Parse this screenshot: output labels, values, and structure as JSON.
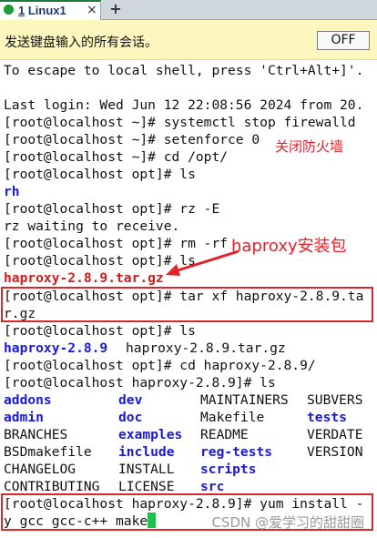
{
  "tab": {
    "number": "1",
    "title": "Linux1",
    "close_glyph": "×",
    "add_glyph": "+"
  },
  "notice": {
    "text": "发送键盘输入的所有会话。",
    "toggle_label": "OFF"
  },
  "terminal": {
    "lines": [
      "To escape to local shell, press 'Ctrl+Alt+]'.",
      "",
      "Last login: Wed Jun 12 22:08:56 2024 from 20.",
      "[root@localhost ~]# systemctl stop firewalld",
      "[root@localhost ~]# setenforce 0",
      "[root@localhost ~]# cd /opt/",
      "[root@localhost opt]# ls",
      "rh",
      "[root@localhost opt]# rz -E",
      "rz waiting to receive.",
      "[root@localhost opt]# rm -rf rh/",
      "[root@localhost opt]# ls",
      "haproxy-2.8.9.tar.gz",
      "[root@localhost opt]# tar xf haproxy-2.8.9.ta",
      "r.gz",
      "[root@localhost opt]# ls",
      "",
      "[root@localhost opt]# cd haproxy-2.8.9/",
      "[root@localhost haproxy-2.8.9]# ls",
      "[root@localhost haproxy-2.8.9]# yum install -",
      "y gcc gcc-c++ make"
    ],
    "ls_after_extract": [
      "haproxy-2.8.9",
      "haproxy-2.8.9.tar.gz"
    ],
    "dir_listing": [
      [
        "addons",
        "dev",
        "MAINTAINERS",
        "SUBVERS"
      ],
      [
        "admin",
        "doc",
        "Makefile",
        "tests"
      ],
      [
        "BRANCHES",
        "examples",
        "README",
        "VERDATE"
      ],
      [
        "BSDmakefile",
        "include",
        "reg-tests",
        "VERSION"
      ],
      [
        "CHANGELOG",
        "INSTALL",
        "scripts",
        ""
      ],
      [
        "CONTRIBUTING",
        "LICENSE",
        "src",
        ""
      ]
    ]
  },
  "annotations": {
    "firewall": "关闭防火墙",
    "package": "haproxy安装包"
  },
  "watermark": "CSDN @爱学习的甜甜圈",
  "colors": {
    "accent_red": "#d9272e",
    "dir_blue": "#1a1ad6",
    "cursor_green": "#22c04a",
    "notice_bg": "#fdf6bf"
  }
}
